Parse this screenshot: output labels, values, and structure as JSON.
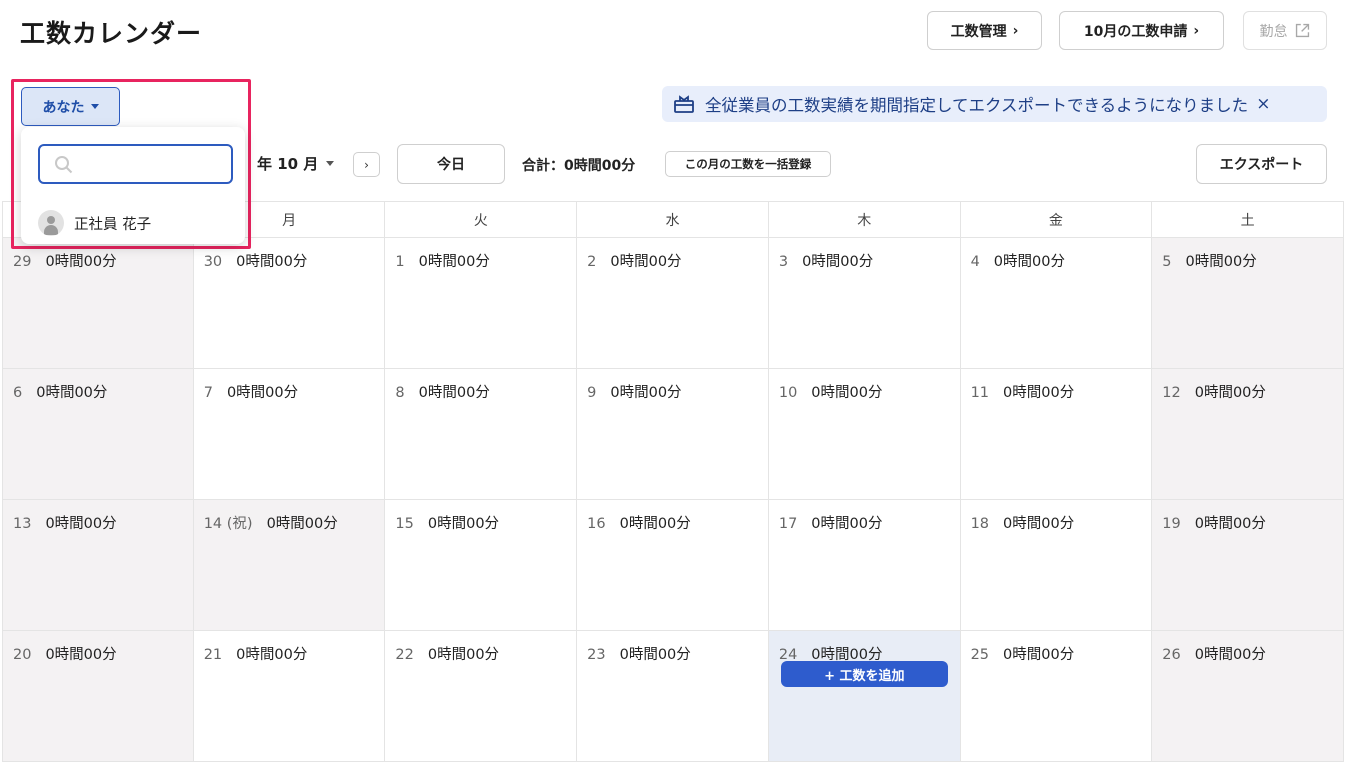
{
  "header": {
    "title": "工数カレンダー",
    "buttons": {
      "kosu_manage": "工数管理",
      "monthly_apply": "10月の工数申請",
      "kintai": "勤怠"
    }
  },
  "user_select": {
    "label": "あなた"
  },
  "banner": {
    "text": "全従業員の工数実績を期間指定してエクスポートできるようになりました",
    "close": "×"
  },
  "toolbar": {
    "month_label": "年 10 月",
    "next": "›",
    "today": "今日",
    "total": "合計：0時間00分",
    "bulk_register": "この月の工数を一括登録",
    "export": "エクスポート"
  },
  "dropdown": {
    "search_placeholder": "",
    "users": [
      "正社員 花子"
    ]
  },
  "calendar": {
    "weekdays": [
      "",
      "月",
      "火",
      "水",
      "木",
      "金",
      "土"
    ],
    "weeks": [
      [
        {
          "d": "29",
          "t": "0時間00分",
          "type": "weekend"
        },
        {
          "d": "30",
          "t": "0時間00分",
          "type": ""
        },
        {
          "d": "1",
          "t": "0時間00分",
          "type": ""
        },
        {
          "d": "2",
          "t": "0時間00分",
          "type": ""
        },
        {
          "d": "3",
          "t": "0時間00分",
          "type": ""
        },
        {
          "d": "4",
          "t": "0時間00分",
          "type": ""
        },
        {
          "d": "5",
          "t": "0時間00分",
          "type": "weekend"
        }
      ],
      [
        {
          "d": "6",
          "t": "0時間00分",
          "type": "weekend"
        },
        {
          "d": "7",
          "t": "0時間00分",
          "type": ""
        },
        {
          "d": "8",
          "t": "0時間00分",
          "type": ""
        },
        {
          "d": "9",
          "t": "0時間00分",
          "type": ""
        },
        {
          "d": "10",
          "t": "0時間00分",
          "type": ""
        },
        {
          "d": "11",
          "t": "0時間00分",
          "type": ""
        },
        {
          "d": "12",
          "t": "0時間00分",
          "type": "weekend"
        }
      ],
      [
        {
          "d": "13",
          "t": "0時間00分",
          "type": "weekend"
        },
        {
          "d": "14 (祝)",
          "t": "0時間00分",
          "type": "holiday"
        },
        {
          "d": "15",
          "t": "0時間00分",
          "type": ""
        },
        {
          "d": "16",
          "t": "0時間00分",
          "type": ""
        },
        {
          "d": "17",
          "t": "0時間00分",
          "type": ""
        },
        {
          "d": "18",
          "t": "0時間00分",
          "type": ""
        },
        {
          "d": "19",
          "t": "0時間00分",
          "type": "weekend"
        }
      ],
      [
        {
          "d": "20",
          "t": "0時間00分",
          "type": "weekend"
        },
        {
          "d": "21",
          "t": "0時間00分",
          "type": ""
        },
        {
          "d": "22",
          "t": "0時間00分",
          "type": ""
        },
        {
          "d": "23",
          "t": "0時間00分",
          "type": ""
        },
        {
          "d": "24",
          "t": "0時間00分",
          "type": "today"
        },
        {
          "d": "25",
          "t": "0時間00分",
          "type": ""
        },
        {
          "d": "26",
          "t": "0時間00分",
          "type": "weekend"
        }
      ]
    ],
    "add_button": "+ 工数を追加"
  },
  "colors": {
    "accent": "#2e5ccd",
    "highlight": "#e8245f",
    "banner_bg": "#e8eefb"
  }
}
